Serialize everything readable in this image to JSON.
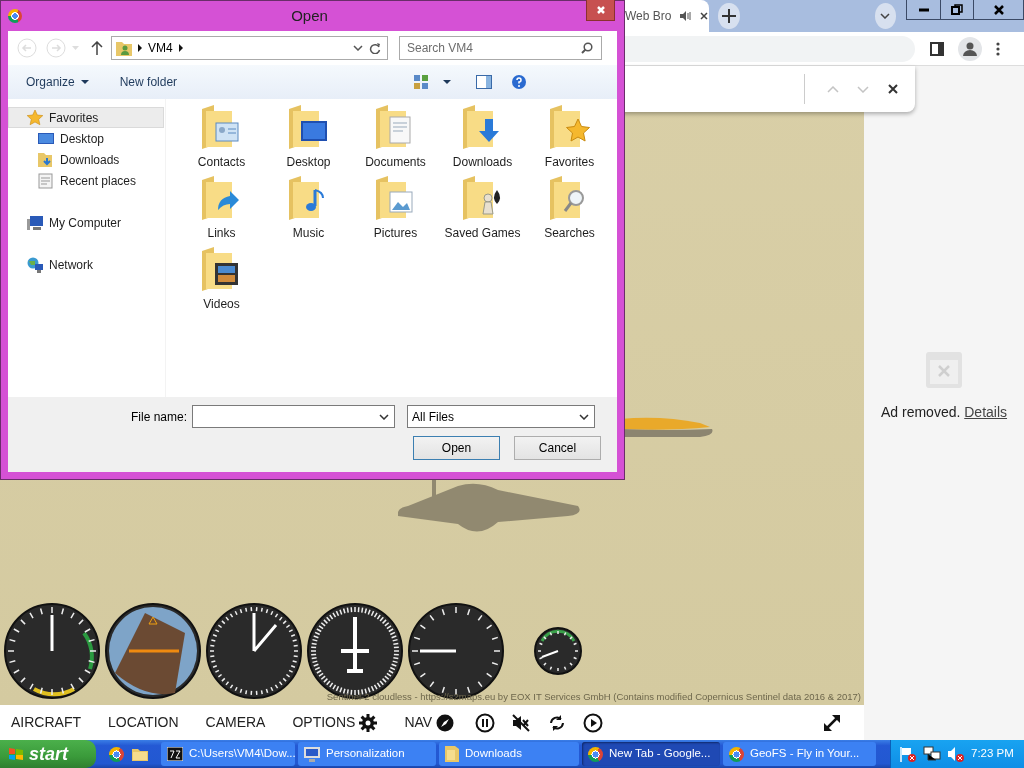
{
  "browser": {
    "tab_title": "Web Bro"
  },
  "game": {
    "menu": [
      {
        "label": "AIRCRAFT",
        "kind": "text"
      },
      {
        "label": "LOCATION",
        "kind": "text"
      },
      {
        "label": "CAMERA",
        "kind": "text"
      },
      {
        "label": "OPTIONS",
        "kind": "gear"
      },
      {
        "label": "NAV",
        "kind": "compass"
      }
    ],
    "attribution": "Sentinel-2 cloudless - https://s2maps.eu by EOX IT Services GmbH (Contains modified Copernicus Sentinel data 2016 & 2017)"
  },
  "ad": {
    "text": "Ad removed.",
    "link": "Details"
  },
  "dialog": {
    "title": "Open",
    "path": [
      "VM4"
    ],
    "search_placeholder": "Search VM4",
    "commands": [
      "Organize",
      "New folder"
    ],
    "nav": [
      {
        "label": "Favorites",
        "kind": "star",
        "selected": true,
        "children": [
          {
            "label": "Desktop",
            "kind": "desktop",
            "selected": false
          },
          {
            "label": "Downloads",
            "kind": "downloads",
            "selected": false
          },
          {
            "label": "Recent places",
            "kind": "recent",
            "selected": false
          }
        ]
      },
      {
        "label": "My Computer",
        "kind": "computer",
        "selected": false
      },
      {
        "label": "Network",
        "kind": "network",
        "selected": false
      }
    ],
    "folders": [
      {
        "label": "Contacts",
        "kind": "contacts"
      },
      {
        "label": "Desktop",
        "kind": "desktop"
      },
      {
        "label": "Documents",
        "kind": "documents"
      },
      {
        "label": "Downloads",
        "kind": "downloads"
      },
      {
        "label": "Favorites",
        "kind": "favorites"
      },
      {
        "label": "Links",
        "kind": "links"
      },
      {
        "label": "Music",
        "kind": "music"
      },
      {
        "label": "Pictures",
        "kind": "pictures"
      },
      {
        "label": "Saved Games",
        "kind": "games"
      },
      {
        "label": "Searches",
        "kind": "searches"
      },
      {
        "label": "Videos",
        "kind": "videos"
      }
    ],
    "file_name_label": "File name:",
    "file_type": "All Files",
    "buttons": [
      "Open",
      "Cancel"
    ]
  },
  "taskbar": {
    "start": "start",
    "tasks": [
      {
        "label": "C:\\Users\\VM4\\Dow...",
        "kind": "archive",
        "selected": false
      },
      {
        "label": "Personalization",
        "kind": "monitor",
        "selected": false
      },
      {
        "label": "Downloads",
        "kind": "folder",
        "selected": false
      },
      {
        "label": "New Tab - Google...",
        "kind": "browser",
        "selected": true
      },
      {
        "label": "GeoFS - Fly in Your...",
        "kind": "browser",
        "selected": false
      }
    ],
    "clock": "7:23 PM"
  }
}
